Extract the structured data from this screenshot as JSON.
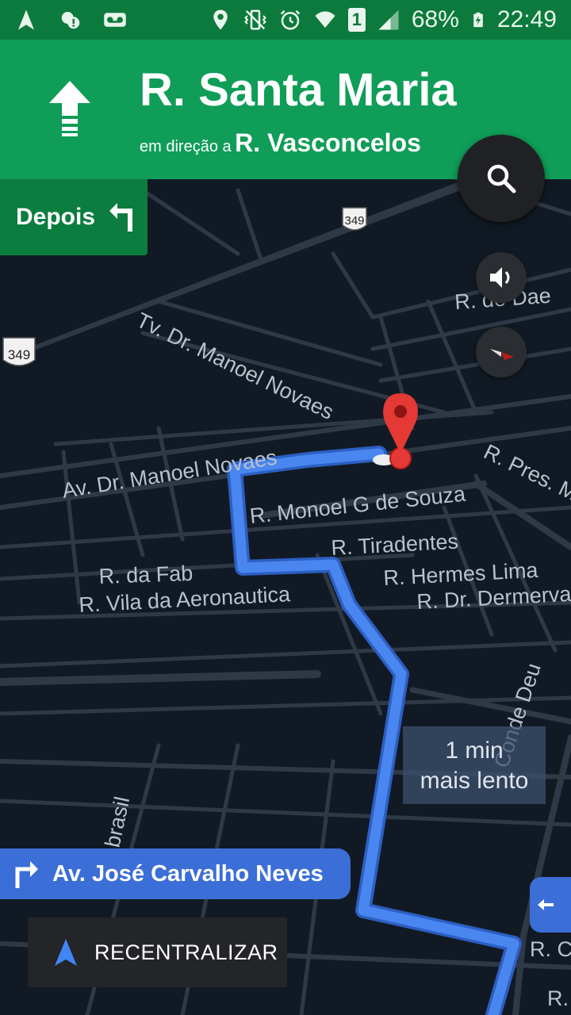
{
  "status_bar": {
    "battery": "68%",
    "time": "22:49",
    "sim_slot": "1"
  },
  "navigation": {
    "current_street": "R. Santa Maria",
    "toward_prefix": "em direção a",
    "toward_street": "R. Vasconcelos",
    "then_label": "Depois"
  },
  "map": {
    "highway_shield": "349",
    "labels": {
      "tv_manoel_novaes": "Tv. Dr. Manoel Novaes",
      "av_manoel_novaes": "Av. Dr. Manoel Novaes",
      "monoel_souza": "R. Monoel G de Souza",
      "tiradentes": "R. Tiradentes",
      "hermes_lima": "R. Hermes Lima",
      "dermerval": "R. Dr. Dermerva",
      "da_fab": "R. da Fab",
      "vila_aeronautica": "R. Vila da Aeronautica",
      "pres": "R. Pres. M",
      "de_dae": "R. de Dae",
      "conde_deu": "Conde Deu",
      "brasil": "brasil",
      "r_c": "R. C",
      "r_partial": "R."
    },
    "traffic_delay": {
      "line1": "1 min",
      "line2": "mais lento"
    }
  },
  "next_street": {
    "label": "Av. José Carvalho Neves"
  },
  "recenter_button": {
    "label": "RECENTRALIZAR"
  },
  "colors": {
    "header_green": "#0f9d58",
    "status_green": "#0c7a3c",
    "route_blue": "#4a86f0",
    "map_bg": "#111a24",
    "pin_red": "#e53935"
  },
  "icons": {
    "nav_direction": "straight-arrow-icon",
    "then_direction": "turn-left-icon",
    "search": "search-icon",
    "sound": "volume-icon",
    "compass": "compass-icon",
    "next_turn": "turn-right-icon",
    "recenter": "navigation-arrow-icon",
    "destination": "map-pin-icon"
  }
}
